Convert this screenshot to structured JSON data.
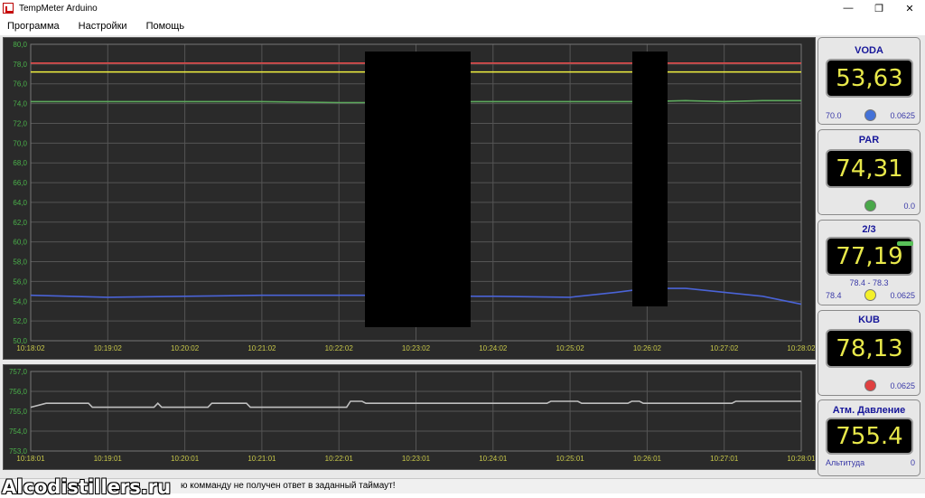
{
  "window": {
    "title": "TempMeter Arduino",
    "minimize": "—",
    "maximize": "❐",
    "close": "✕"
  },
  "menu": {
    "program": "Программа",
    "settings": "Настройки",
    "help": "Помощь"
  },
  "sensors": [
    {
      "name": "VODA",
      "value": "53,63",
      "left_label": "70.0",
      "right_label": "0.0625",
      "dot_color": "#4472d8"
    },
    {
      "name": "PAR",
      "value": "74,31",
      "left_label": "",
      "right_label": "0.0",
      "dot_color": "#4aa84a"
    },
    {
      "name": "2/3",
      "value": "77,19",
      "range": "78.4 - 78.3",
      "left_label": "78.4",
      "right_label": "0.0625",
      "dot_color": "#f4f02a"
    },
    {
      "name": "KUB",
      "value": "78,13",
      "left_label": "",
      "right_label": "0.0625",
      "dot_color": "#e04040"
    },
    {
      "name": "Атм. Давление",
      "value": "755.4",
      "left_label": "Альтитуда",
      "right_label": "0"
    }
  ],
  "colors": {
    "voda": "#4a63d6",
    "par": "#5ca85c",
    "two_thirds": "#f0f040",
    "kub": "#e04848",
    "pressure": "#bfbfbf",
    "grid": "#555555",
    "tick_label": "#c8c84a",
    "y_label": "#4ab04a"
  },
  "status": {
    "message": "ю комманду не получен ответ в заданный таймаут!",
    "watermark": "Alcodistillers.ru"
  },
  "chart_data": [
    {
      "type": "line",
      "y_ticks": [
        "80,0",
        "78,0",
        "76,0",
        "74,0",
        "72,0",
        "70,0",
        "68,0",
        "66,0",
        "64,0",
        "62,0",
        "60,0",
        "58,0",
        "56,0",
        "54,0",
        "52,0",
        "50,0"
      ],
      "ylim": [
        50,
        80
      ],
      "x_ticks": [
        "10:18:02",
        "10:19:02",
        "10:20:02",
        "10:21:02",
        "10:22:02",
        "10:23:02",
        "10:24:02",
        "10:25:02",
        "10:26:02",
        "10:27:02",
        "10:28:02"
      ],
      "x": [
        0,
        1,
        2,
        3,
        4,
        4.3,
        5.8,
        6,
        7,
        7.6,
        8,
        8.5,
        9,
        9.5,
        10
      ],
      "series": [
        {
          "values": [
            78.1,
            78.1,
            78.1,
            78.1,
            78.1,
            78.1,
            78.1,
            78.1,
            78.1,
            78.1,
            78.1,
            78.1,
            78.1,
            78.1,
            78.1
          ]
        },
        {
          "values": [
            77.2,
            77.2,
            77.2,
            77.2,
            77.2,
            77.2,
            77.2,
            77.2,
            77.2,
            77.2,
            77.2,
            77.2,
            77.2,
            77.2,
            77.2
          ]
        },
        {
          "values": [
            74.2,
            74.2,
            74.2,
            74.2,
            74.1,
            74.1,
            74.2,
            74.2,
            74.2,
            74.2,
            74.2,
            74.3,
            74.2,
            74.3,
            74.3
          ]
        },
        {
          "values": [
            54.6,
            54.4,
            54.5,
            54.6,
            54.6,
            54.6,
            54.5,
            54.5,
            54.4,
            54.9,
            55.3,
            55.3,
            54.9,
            54.5,
            53.7
          ]
        }
      ]
    },
    {
      "type": "line",
      "y_ticks": [
        "757,0",
        "756,0",
        "755,0",
        "754,0",
        "753,0"
      ],
      "ylim": [
        753,
        757
      ],
      "x_ticks": [
        "10:18:01",
        "10:19:01",
        "10:20:01",
        "10:21:01",
        "10:22:01",
        "10:23:01",
        "10:24:01",
        "10:25:01",
        "10:26:01",
        "10:27:01",
        "10:28:01"
      ],
      "x": [
        0,
        0.2,
        0.75,
        0.8,
        1.6,
        1.65,
        1.7,
        2.3,
        2.35,
        2.8,
        2.85,
        4.1,
        4.15,
        4.3,
        4.35,
        6.7,
        6.75,
        7.1,
        7.15,
        7.75,
        7.8,
        7.9,
        7.95,
        9.1,
        9.15,
        10
      ],
      "series": [
        {
          "values": [
            755.2,
            755.4,
            755.4,
            755.2,
            755.2,
            755.4,
            755.2,
            755.2,
            755.4,
            755.4,
            755.2,
            755.2,
            755.5,
            755.5,
            755.4,
            755.4,
            755.5,
            755.5,
            755.4,
            755.4,
            755.5,
            755.5,
            755.4,
            755.4,
            755.5,
            755.5
          ]
        }
      ]
    }
  ]
}
